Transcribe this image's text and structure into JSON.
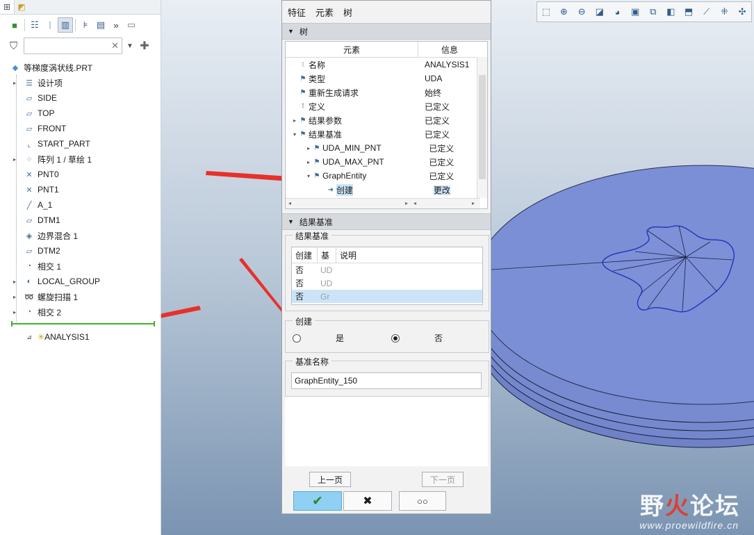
{
  "left_panel": {
    "tabs": [
      "model-tree-icon",
      "layer-tree-icon"
    ],
    "toolbar_icons": [
      "cube-icon",
      "tree-columns-icon",
      "tree-filter-icon",
      "columns-icon",
      "show-icon",
      "settings-icon",
      "more-icon",
      "page-icon"
    ],
    "filter": {
      "value": "",
      "placeholder": ""
    },
    "root": "等梯度涡状线.PRT",
    "items": [
      {
        "label": "设计项",
        "icon": "list-icon",
        "expand": true
      },
      {
        "label": "SIDE",
        "icon": "plane-icon",
        "expand": false
      },
      {
        "label": "TOP",
        "icon": "plane-icon",
        "expand": false
      },
      {
        "label": "FRONT",
        "icon": "plane-icon",
        "expand": false
      },
      {
        "label": "START_PART",
        "icon": "csys-icon",
        "expand": false
      },
      {
        "label": "阵列 1 / 草绘 1",
        "icon": "pattern-icon",
        "expand": true
      },
      {
        "label": "PNT0",
        "icon": "point-icon",
        "expand": false
      },
      {
        "label": "PNT1",
        "icon": "point-icon",
        "expand": false
      },
      {
        "label": "A_1",
        "icon": "axis-icon",
        "expand": false
      },
      {
        "label": "DTM1",
        "icon": "plane-icon",
        "expand": false
      },
      {
        "label": "边界混合 1",
        "icon": "blend-icon",
        "expand": false
      },
      {
        "label": "DTM2",
        "icon": "plane-icon",
        "expand": false
      },
      {
        "label": "相交 1",
        "icon": "intersect-icon",
        "expand": false
      },
      {
        "label": "LOCAL_GROUP",
        "icon": "group-icon",
        "expand": true
      },
      {
        "label": "螺旋扫描 1",
        "icon": "helix-icon",
        "expand": true
      },
      {
        "label": "相交 2",
        "icon": "intersect-icon",
        "expand": true
      }
    ],
    "analysis_item": "ANALYSIS1"
  },
  "dialog": {
    "menu": [
      "特征",
      "元素",
      "树"
    ],
    "tree_section": "树",
    "tree_columns": [
      "元素",
      "信息"
    ],
    "tree_rows": [
      {
        "label": "名称",
        "info": "ANALYSIS1",
        "indent": 0,
        "expand": "",
        "icon": "name-icon"
      },
      {
        "label": "类型",
        "info": "UDA",
        "indent": 0,
        "expand": "",
        "icon": "flag-icon"
      },
      {
        "label": "重新生成请求",
        "info": "始终",
        "indent": 0,
        "expand": "",
        "icon": "flag-icon"
      },
      {
        "label": "定义",
        "info": "已定义",
        "indent": 0,
        "expand": "",
        "icon": "define-icon"
      },
      {
        "label": "结果参数",
        "info": "已定义",
        "indent": 0,
        "expand": "▸",
        "icon": "flag-icon"
      },
      {
        "label": "结果基准",
        "info": "已定义",
        "indent": 0,
        "expand": "▾",
        "icon": "flag-icon"
      },
      {
        "label": "UDA_MIN_PNT",
        "info": "已定义",
        "indent": 1,
        "expand": "▸",
        "icon": "flag-icon"
      },
      {
        "label": "UDA_MAX_PNT",
        "info": "已定义",
        "indent": 1,
        "expand": "▸",
        "icon": "flag-icon"
      },
      {
        "label": "GraphEntity",
        "info": "已定义",
        "indent": 1,
        "expand": "▾",
        "icon": "flag-icon"
      },
      {
        "label": "创建",
        "info": "更改",
        "indent": 2,
        "expand": "",
        "icon": "arrow-right-icon",
        "selected": true
      }
    ],
    "result_section": "结果基准",
    "result_group": {
      "title": "结果基准",
      "columns": [
        "创建",
        "基",
        "说明"
      ],
      "rows": [
        {
          "create": "否",
          "base": "UD",
          "desc": ""
        },
        {
          "create": "否",
          "base": "UD",
          "desc": ""
        },
        {
          "create": "否",
          "base": "Gr",
          "desc": "",
          "selected": true
        }
      ]
    },
    "create_group": {
      "title": "创建",
      "yes": "是",
      "no": "否",
      "selected": "no"
    },
    "name_group": {
      "title": "基准名称",
      "value": "GraphEntity_150"
    },
    "buttons": {
      "prev": "上一页",
      "next": "下一页"
    }
  },
  "viewport": {
    "toolbar_icons": [
      "refit-icon",
      "zoom-in-icon",
      "zoom-out-icon",
      "repaint-icon",
      "display-style-icon",
      "saved-views-icon",
      "view-manager-icon",
      "perspective-icon",
      "section-icon",
      "datum-display-icon",
      "annotation-icon",
      "spin-center-icon"
    ],
    "disc_color": "#7b8fd6"
  },
  "watermark": {
    "name_a": "野",
    "name_b": "火",
    "name_c": "论坛",
    "url": "www.proewildfire.cn"
  }
}
